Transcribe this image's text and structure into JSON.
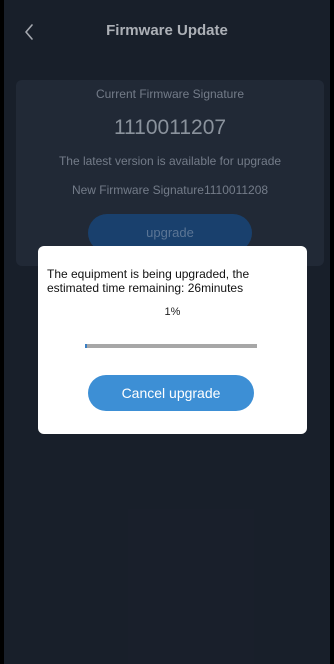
{
  "header": {
    "title": "Firmware Update",
    "back_icon": "chevron-left-icon"
  },
  "card": {
    "signature_label": "Current Firmware Signature",
    "signature_value": "1110011207",
    "latest_text": "The latest version is available for upgrade",
    "new_signature_text": "New Firmware Signature1110011208",
    "upgrade_label": "upgrade"
  },
  "dialog": {
    "message": "The equipment is being upgraded, the estimated time remaining: 26minutes",
    "percent_text": "1%",
    "progress": 0.01,
    "cancel_label": "Cancel upgrade"
  },
  "colors": {
    "background": "#1e2634",
    "card": "#293343",
    "accent": "#3d8fd5",
    "dialog": "#ffffff"
  }
}
